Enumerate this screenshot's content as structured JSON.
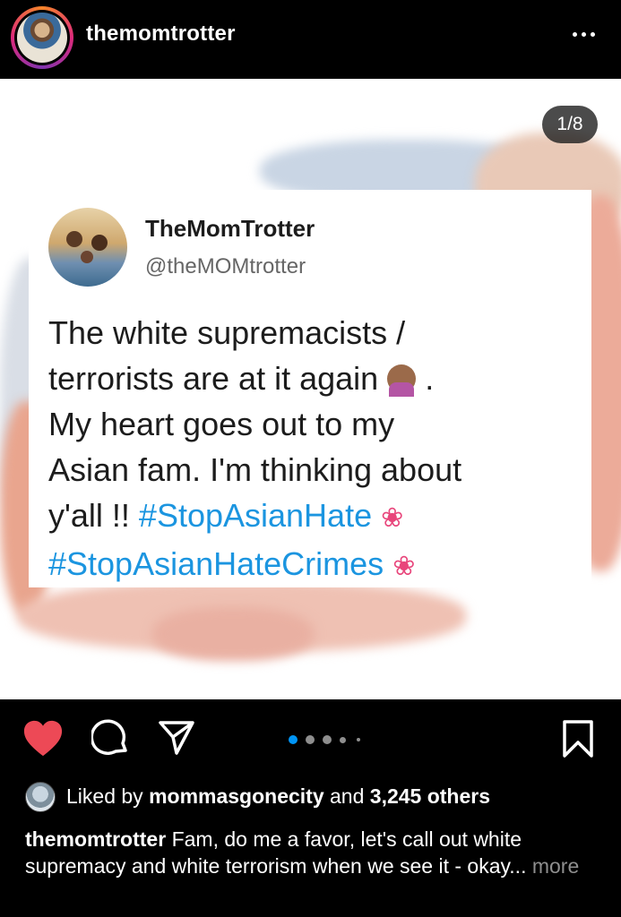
{
  "header": {
    "username": "themomtrotter"
  },
  "post": {
    "counter": "1/8",
    "tweet": {
      "name": "TheMomTrotter",
      "handle": "@theMOMtrotter",
      "line1": "The white supremacists /",
      "line2": "terrorists are at it again",
      "line2_end": ".",
      "line3": "My heart goes out to my",
      "line4": "Asian fam. I'm thinking about",
      "line5_text": "y'all !!",
      "hashtag1": "#StopAsianHate",
      "hashtag2": "#StopAsianHateCrimes",
      "lotus_glyph": "❀"
    }
  },
  "actions": {
    "carousel": {
      "total": 8,
      "active": 1
    }
  },
  "likes": {
    "prefix": "Liked by",
    "user": "mommasgonecity",
    "middle": "and",
    "count": "3,245 others"
  },
  "caption": {
    "username": "themomtrotter",
    "text": "Fam, do me a favor, let's call out white supremacy and white terrorism when we see it - okay...",
    "more": "more"
  },
  "colors": {
    "like_red": "#ed4956",
    "hashtag_blue": "#1b95e0",
    "carousel_active": "#0095f6"
  }
}
